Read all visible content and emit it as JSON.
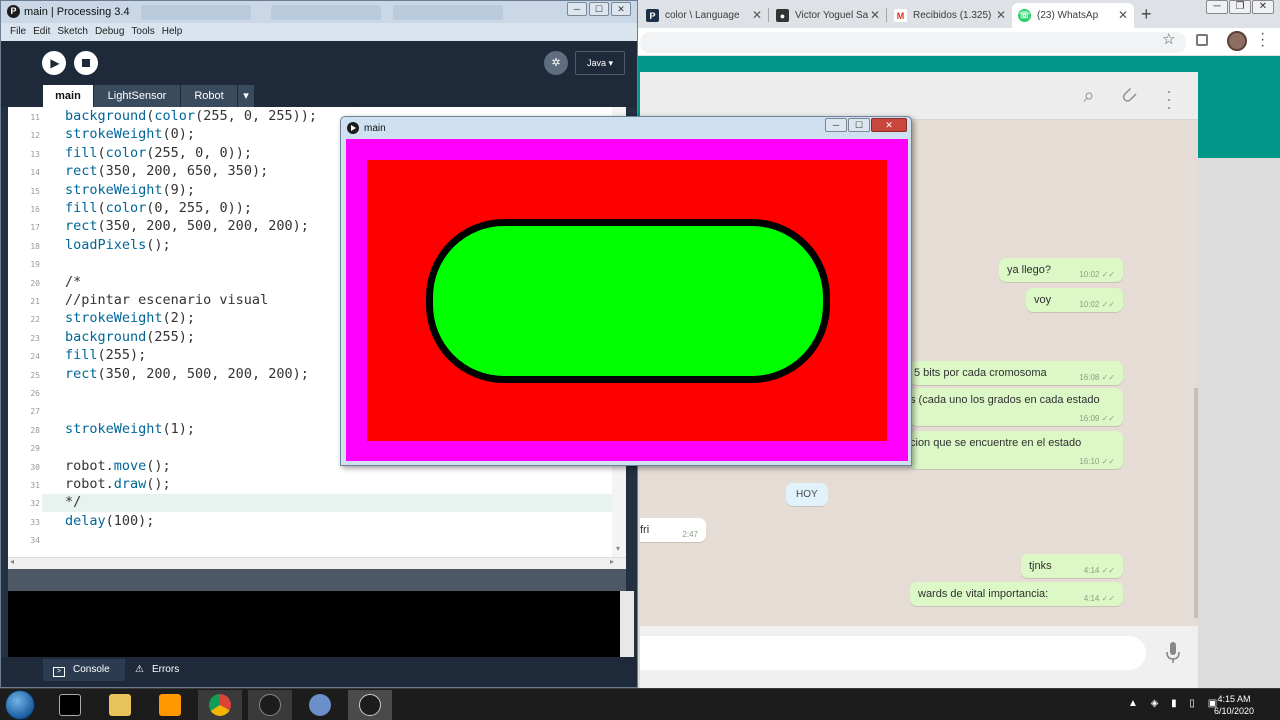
{
  "chrome": {
    "tabs": [
      {
        "label": "color \\ Language",
        "icon": "processing-p-icon"
      },
      {
        "label": "Victor Yoguel Sa",
        "icon": "person-icon"
      },
      {
        "label": "Recibidos (1.325)",
        "icon": "gmail-icon"
      },
      {
        "label": "(23) WhatsAp",
        "icon": "whatsapp-icon"
      }
    ]
  },
  "whatsapp": {
    "messages": [
      {
        "text": "ya llego?",
        "time": "10:02"
      },
      {
        "text": "voy",
        "time": "10:02"
      },
      {
        "text": "5 bits por cada cromosoma",
        "time": "16:08"
      },
      {
        "text": "s (cada uno los grados en cada estado",
        "time": "16:09"
      },
      {
        "text": "cion que se encuentre en el estado",
        "time": "16:10"
      },
      {
        "text": "tjnks",
        "time": "4:14"
      },
      {
        "text": "wards de vital importancia:",
        "time": "4:14"
      }
    ],
    "day_chip": "HOY",
    "incoming": {
      "text": "fri",
      "time": "2:47"
    }
  },
  "processing": {
    "window_title": "main | Processing 3.4",
    "menu": [
      "File",
      "Edit",
      "Sketch",
      "Debug",
      "Tools",
      "Help"
    ],
    "mode": "Java ▾",
    "tabs": [
      "main",
      "LightSensor",
      "Robot",
      "▾"
    ],
    "line_numbers": [
      "11",
      "12",
      "13",
      "14",
      "15",
      "16",
      "17",
      "18",
      "19",
      "20",
      "21",
      "22",
      "23",
      "24",
      "25",
      "26",
      "27",
      "28",
      "29",
      "30",
      "31",
      "32",
      "33",
      "34"
    ],
    "code_lines": [
      "background(color(255, 0, 255));",
      "strokeWeight(0);",
      "fill(color(255, 0, 0));",
      "rect(350, 200, 650, 350);",
      "strokeWeight(9);",
      "fill(color(0, 255, 0));",
      "rect(350, 200, 500, 200, 200);",
      "loadPixels();",
      "",
      "/*",
      "//pintar escenario visual",
      "strokeWeight(2);",
      "background(255);",
      "fill(255);",
      "rect(350, 200, 500, 200, 200);",
      "",
      "",
      "strokeWeight(1);",
      "",
      "robot.move();",
      "robot.draw();",
      "*/",
      "delay(100);",
      ""
    ],
    "console_tabs": [
      "Console",
      "Errors"
    ]
  },
  "sketch": {
    "title": "main",
    "colors": {
      "background": "#ff00ff",
      "rect": "#ff0000",
      "rounded": "#00ff00"
    }
  },
  "taskbar": {
    "time": "4:15 AM",
    "date": "6/10/2020"
  }
}
